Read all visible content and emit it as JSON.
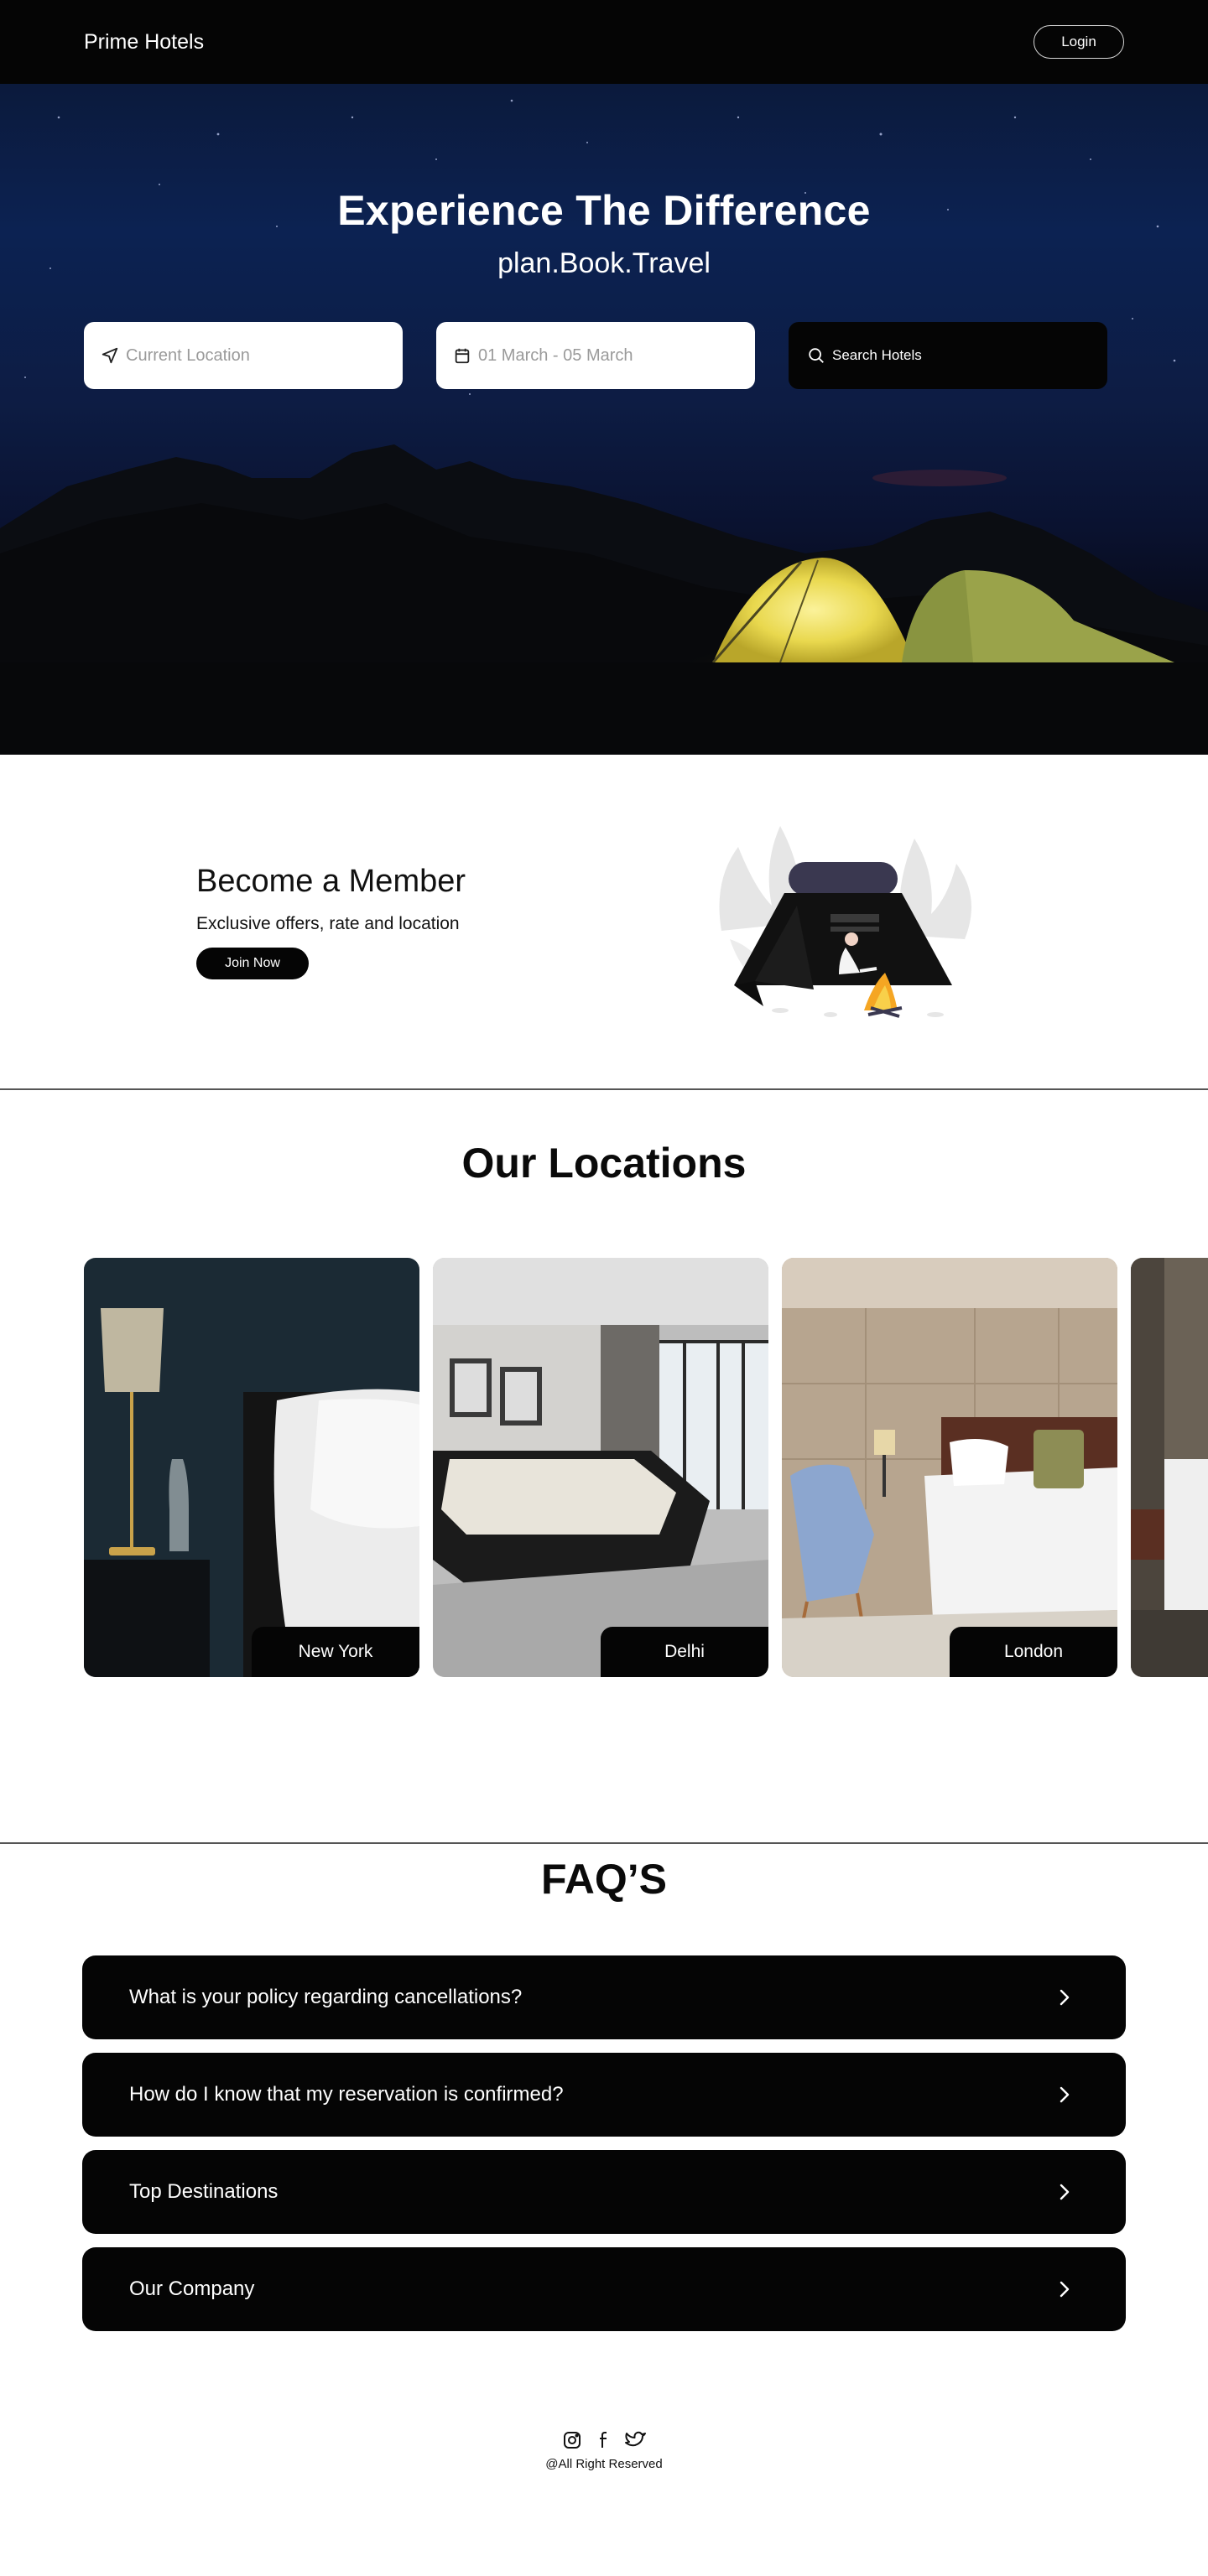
{
  "nav": {
    "brand": "Prime Hotels",
    "login_label": "Login"
  },
  "hero": {
    "title": "Experience The Difference",
    "subtitle": "plan.Book.Travel",
    "location_placeholder": "Current Location",
    "location_icon": "location-arrow-icon",
    "date_placeholder": "01 March - 05 March",
    "date_icon": "calendar-icon",
    "search_label": "Search Hotels",
    "search_icon": "search-icon"
  },
  "member": {
    "title": "Become a Member",
    "subtitle": "Exclusive offers, rate and location",
    "join_label": "Join Now"
  },
  "locations": {
    "title": "Our Locations",
    "cards": [
      {
        "label": "New York"
      },
      {
        "label": "Delhi"
      },
      {
        "label": "London"
      }
    ]
  },
  "faq": {
    "title": "FAQ’S",
    "items": [
      {
        "question": "What is your policy regarding cancellations?"
      },
      {
        "question": "How do I know that my reservation is confirmed?"
      },
      {
        "question": "Top Destinations"
      },
      {
        "question": "Our Company"
      }
    ]
  },
  "footer": {
    "social_icons": [
      "instagram-icon",
      "facebook-icon",
      "twitter-icon"
    ],
    "copyright": "@All Right Reserved"
  },
  "colors": {
    "primary": "#050505",
    "background": "#ffffff",
    "hero_sky": "#0c2252",
    "tent_glow": "#f2e36a"
  }
}
